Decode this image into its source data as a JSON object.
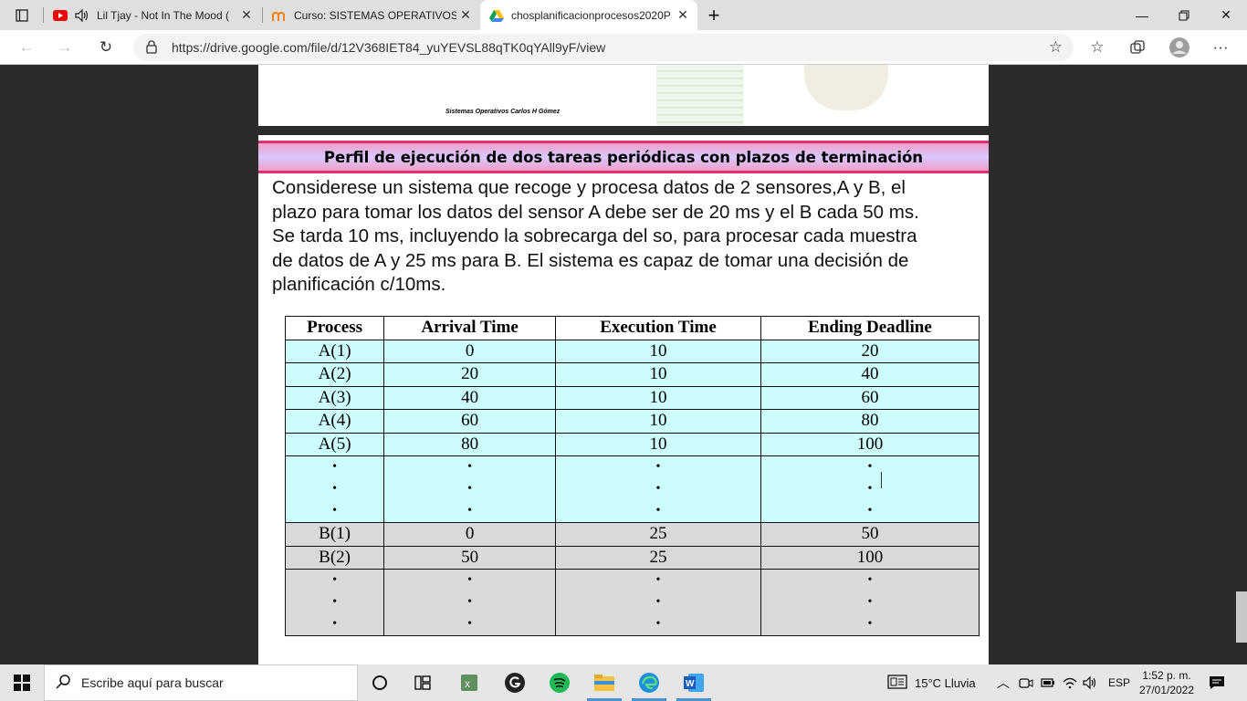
{
  "tabs": [
    {
      "title": "Lil Tjay - Not In The Mood (",
      "icon": "youtube-icon"
    },
    {
      "title": "Curso: SISTEMAS OPERATIVOS (r",
      "icon": "moodle-icon"
    },
    {
      "title": "chosplanificacionprocesos2020P",
      "icon": "google-drive-icon"
    }
  ],
  "address": {
    "url": "https://drive.google.com/file/d/12V368IET84_yuYEVSL88qTK0qYAll9yF/view"
  },
  "page1": {
    "footer": "Sistemas Operativos Carlos H Gómez"
  },
  "slide": {
    "heading": "Perfil de ejecución de dos tareas periódicas con plazos de terminación",
    "lines": [
      "Considerese un sistema que recoge y procesa datos de 2 sensores,A y B, el",
      "plazo para tomar los datos del sensor A debe ser de 20 ms y el B cada 50 ms.",
      "Se tarda 10 ms, incluyendo la sobrecarga del so, para procesar cada muestra",
      "de datos de A y 25 ms para B.  El sistema es capaz de tomar una decisión de",
      "planificación c/10ms."
    ],
    "table": {
      "headers": [
        "Process",
        "Arrival Time",
        "Execution Time",
        "Ending Deadline"
      ],
      "a_rows": [
        [
          "A(1)",
          "0",
          "10",
          "20"
        ],
        [
          "A(2)",
          "20",
          "10",
          "40"
        ],
        [
          "A(3)",
          "40",
          "10",
          "60"
        ],
        [
          "A(4)",
          "60",
          "10",
          "80"
        ],
        [
          "A(5)",
          "80",
          "10",
          "100"
        ]
      ],
      "b_rows": [
        [
          "B(1)",
          "0",
          "25",
          "50"
        ],
        [
          "B(2)",
          "50",
          "25",
          "100"
        ]
      ],
      "dots": "•"
    }
  },
  "taskbar": {
    "search_placeholder": "Escribe aquí para buscar",
    "weather": "15°C  Lluvia",
    "lang": "ESP",
    "time": "1:52 p. m.",
    "date": "27/01/2022"
  }
}
